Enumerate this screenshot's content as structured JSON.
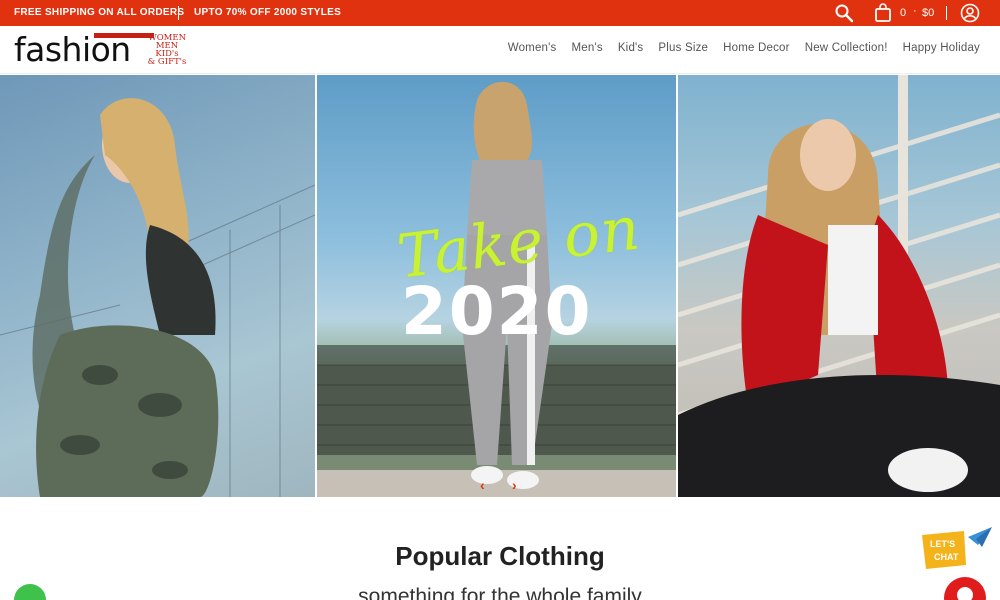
{
  "promo": {
    "left_text": "FREE SHIPPING ON ALL ORDERS",
    "right_text": "UPTO 70% OFF 2000 STYLES",
    "cart_count": "0",
    "separator": "·",
    "cart_total": "$0"
  },
  "logo": {
    "wordmark": "fashion",
    "tagline": [
      "WOMEN",
      "MEN",
      "KID's",
      "& GIFT's"
    ]
  },
  "nav": {
    "items": [
      "Women's",
      "Men's",
      "Kid's",
      "Plus Size",
      "Home Decor",
      "New Collection!",
      "Happy Holiday"
    ]
  },
  "hero": {
    "headline_script": "Take on",
    "headline_year": "2020",
    "prev_label": "‹",
    "next_label": "›"
  },
  "section": {
    "title": "Popular Clothing",
    "subtitle": "something for the whole family"
  },
  "chat": {
    "badge_line1": "LET'S",
    "badge_line2": "CHAT"
  },
  "colors": {
    "brand_red": "#e0320e",
    "logo_red": "#c62016",
    "headline_green": "#c9f235",
    "whatsapp_green": "#3fc24b"
  }
}
